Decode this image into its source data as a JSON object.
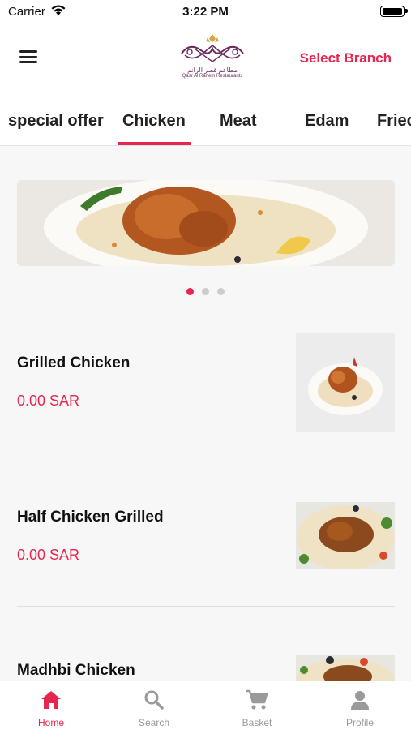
{
  "status_bar": {
    "carrier": "Carrier",
    "time": "3:22 PM"
  },
  "header": {
    "logo_ar": "مطاعم قصر الرانم",
    "logo_en": "Qasr Al Ranem Restaurants",
    "select_branch": "Select Branch"
  },
  "tabs": [
    {
      "label": "special offer",
      "active": false
    },
    {
      "label": "Chicken",
      "active": true
    },
    {
      "label": "Meat",
      "active": false
    },
    {
      "label": "Edam",
      "active": false
    },
    {
      "label": "Fried",
      "active": false
    }
  ],
  "carousel": {
    "slides": 3,
    "active_index": 0
  },
  "items": [
    {
      "name": "Grilled Chicken",
      "price": "0.00 SAR"
    },
    {
      "name": "Half Chicken Grilled",
      "price": "0.00 SAR"
    },
    {
      "name": "Madhbi Chicken",
      "price": ""
    }
  ],
  "bottom_nav": [
    {
      "label": "Home",
      "icon": "home-icon",
      "active": true
    },
    {
      "label": "Search",
      "icon": "search-icon",
      "active": false
    },
    {
      "label": "Basket",
      "icon": "cart-icon",
      "active": false
    },
    {
      "label": "Profile",
      "icon": "person-icon",
      "active": false
    }
  ],
  "colors": {
    "accent": "#e8254f",
    "logo": "#6b2c5e",
    "inactive": "#9a9a9a"
  }
}
